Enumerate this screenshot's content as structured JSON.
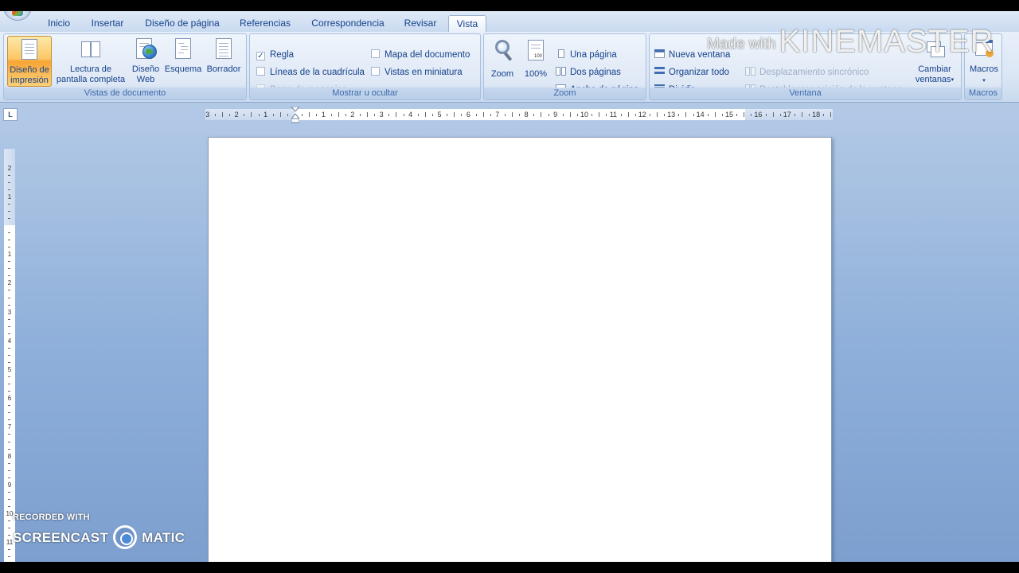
{
  "tabs": [
    "Inicio",
    "Insertar",
    "Diseño de página",
    "Referencias",
    "Correspondencia",
    "Revisar",
    "Vista"
  ],
  "active_tab": "Vista",
  "groups": {
    "vistas": {
      "label": "Vistas de documento",
      "buttons": {
        "impresion": "Diseño de\nimpresión",
        "lectura": "Lectura de\npantalla completa",
        "web": "Diseño\nWeb",
        "esquema": "Esquema",
        "borrador": "Borrador"
      }
    },
    "mostrar": {
      "label": "Mostrar u ocultar",
      "regla": "Regla",
      "regla_checked": true,
      "cuadricula": "Líneas de la cuadrícula",
      "mensajes": "Barra de mensajes",
      "mapa": "Mapa del documento",
      "miniatura": "Vistas en miniatura"
    },
    "zoom": {
      "label": "Zoom",
      "zoom_btn": "Zoom",
      "cien": "100%",
      "una_pagina": "Una página",
      "dos_paginas": "Dos páginas",
      "ancho": "Ancho de página"
    },
    "ventana": {
      "label": "Ventana",
      "nueva": "Nueva ventana",
      "organizar": "Organizar todo",
      "dividir": "Dividir",
      "desplazamiento": "Desplazamiento sincrónico",
      "restablecer": "Restablecer posición de la ventana",
      "cambiar": "Cambiar\nventanas"
    },
    "macros": {
      "label": "Macros",
      "macros_btn": "Macros"
    }
  },
  "ruler": {
    "corner": "L",
    "h_left_numbers": [
      "3",
      "2",
      "1"
    ],
    "h_right_numbers": [
      "1",
      "2",
      "3",
      "4",
      "5",
      "6",
      "7",
      "8",
      "9",
      "10",
      "11",
      "12",
      "13",
      "14",
      "15",
      "16",
      "17",
      "18"
    ],
    "v_top_numbers": [
      "2",
      "1"
    ],
    "v_numbers": [
      "1",
      "2",
      "3",
      "4",
      "5",
      "6",
      "7",
      "8",
      "9",
      "10",
      "11",
      "12"
    ]
  },
  "watermarks": {
    "km_small": "Made with",
    "km_big": "KINEMASTER",
    "sc_recorded": "RECORDED WITH",
    "sc_left": "SCREENCAST",
    "sc_right": "MATIC"
  },
  "colors": {
    "accent_pressed": "#f8a534",
    "ribbon_text": "#15428b",
    "workspace": "#8fb0da"
  }
}
